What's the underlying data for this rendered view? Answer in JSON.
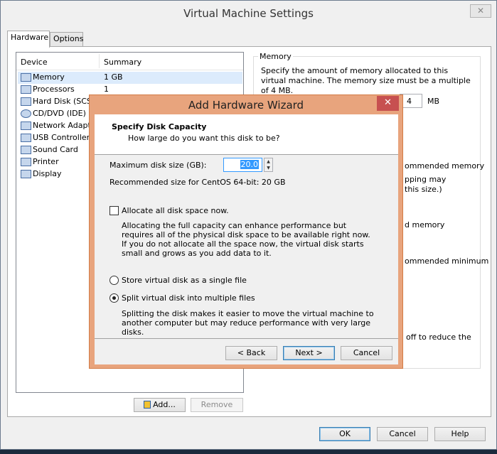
{
  "window": {
    "title": "Virtual Machine Settings",
    "close_glyph": "✕"
  },
  "tabs": [
    {
      "label": "Hardware"
    },
    {
      "label": "Options"
    }
  ],
  "device_list": {
    "col_device": "Device",
    "col_summary": "Summary",
    "rows": [
      {
        "name": "Memory",
        "summary": "1 GB",
        "icon": "memory-icon"
      },
      {
        "name": "Processors",
        "summary": "1",
        "icon": "processor-icon"
      },
      {
        "name": "Hard Disk (SCSI)",
        "summary": "",
        "icon": "hard-disk-icon"
      },
      {
        "name": "CD/DVD (IDE)",
        "summary": "",
        "icon": "cd-dvd-icon"
      },
      {
        "name": "Network Adapter",
        "summary": "",
        "icon": "network-adapter-icon"
      },
      {
        "name": "USB Controller",
        "summary": "",
        "icon": "usb-icon"
      },
      {
        "name": "Sound Card",
        "summary": "",
        "icon": "sound-card-icon"
      },
      {
        "name": "Printer",
        "summary": "",
        "icon": "printer-icon"
      },
      {
        "name": "Display",
        "summary": "",
        "icon": "display-icon"
      }
    ]
  },
  "memory_panel": {
    "legend": "Memory",
    "description": "Specify the amount of memory allocated to this virtual machine. The memory size must be a multiple of 4 MB.",
    "spin_value": "4",
    "unit": "MB",
    "fragments": [
      "ommended memory",
      "pping may",
      "this size.)",
      "d memory",
      "ommended minimum",
      "off to reduce the"
    ]
  },
  "buttons": {
    "add": "Add...",
    "remove": "Remove",
    "ok": "OK",
    "cancel": "Cancel",
    "help": "Help"
  },
  "wizard": {
    "title": "Add Hardware Wizard",
    "close_glyph": "✕",
    "heading": "Specify Disk Capacity",
    "subheading": "How large do you want this disk to be?",
    "max_size_label": "Maximum disk size (GB):",
    "max_size_value": "20.0",
    "recommended": "Recommended size for CentOS 64-bit: 20 GB",
    "allocate_label": "Allocate all disk space now.",
    "allocate_desc": "Allocating the full capacity can enhance performance but requires all of the physical disk space to be available right now. If you do not allocate all the space now, the virtual disk starts small and grows as you add data to it.",
    "single_file_label": "Store virtual disk as a single file",
    "split_label": "Split virtual disk into multiple files",
    "split_desc": "Splitting the disk makes it easier to move the virtual machine to another computer but may reduce performance with very large disks.",
    "back": "< Back",
    "next": "Next >",
    "cancel": "Cancel"
  }
}
